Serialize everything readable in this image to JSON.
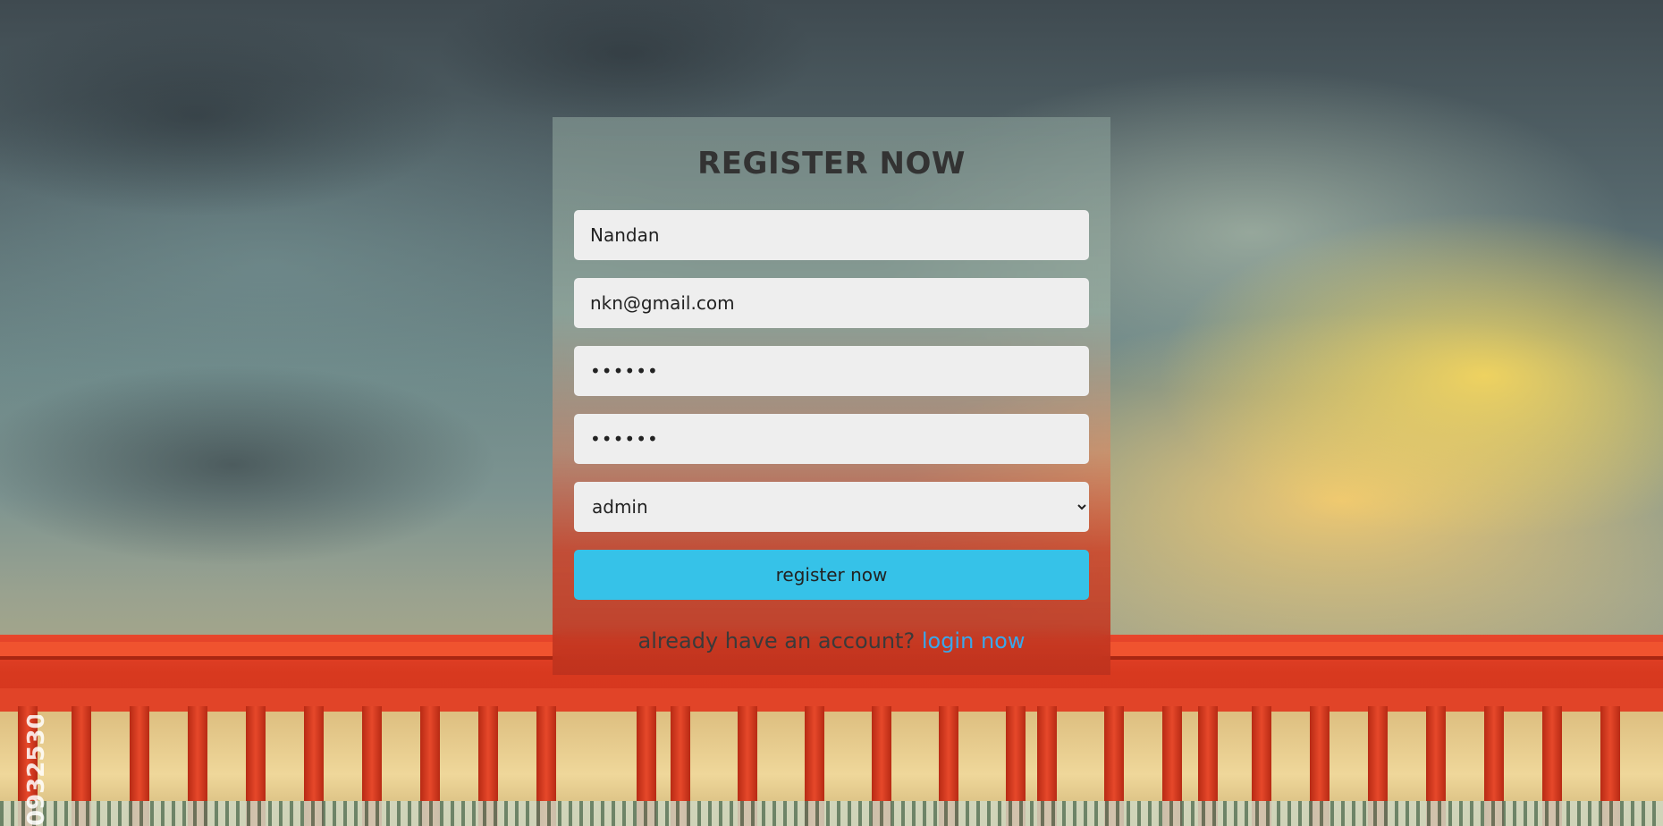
{
  "form": {
    "title": "REGISTER NOW",
    "name_value": "Nandan",
    "email_value": "nkn@gmail.com",
    "password_value": "••••••",
    "confirm_password_value": "••••••",
    "user_type": {
      "selected": "admin",
      "options": [
        "admin"
      ]
    },
    "submit_label": "register now",
    "footer_text": "already have an account?",
    "login_link_label": "login now"
  },
  "background": {
    "stock_id_text": "0932530"
  },
  "colors": {
    "accent": "#36c2e8",
    "link": "#3aa7ea",
    "title": "#333333",
    "field_bg": "#eeeeee"
  }
}
